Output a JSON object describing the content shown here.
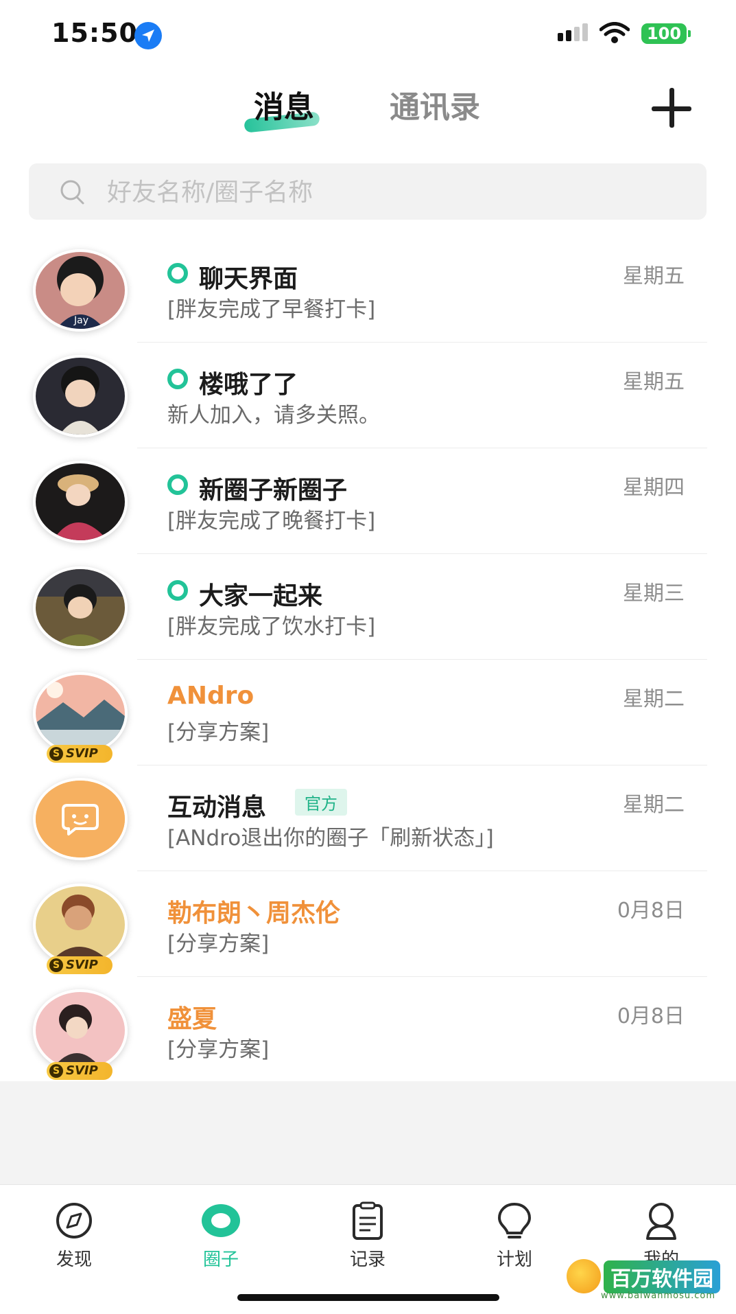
{
  "status_bar": {
    "time": "15:50",
    "battery": "100"
  },
  "header": {
    "tabs": [
      {
        "label": "消息",
        "active": true
      },
      {
        "label": "通讯录",
        "active": false
      }
    ],
    "add_icon": "plus-icon"
  },
  "search": {
    "placeholder": "好友名称/圈子名称"
  },
  "conversations": [
    {
      "title": "聊天界面",
      "subtitle": "[胖友完成了早餐打卡]",
      "date": "星期五",
      "circle": true,
      "svip": false
    },
    {
      "title": "楼哦了了",
      "subtitle": "新人加入，请多关照。",
      "date": "星期五",
      "circle": true,
      "svip": false
    },
    {
      "title": "新圈子新圈子",
      "subtitle": "[胖友完成了晚餐打卡]",
      "date": "星期四",
      "circle": true,
      "svip": false
    },
    {
      "title": "大家一起来",
      "subtitle": "[胖友完成了饮水打卡]",
      "date": "星期三",
      "circle": true,
      "svip": false
    },
    {
      "title": "ANdro",
      "subtitle": "[分享方案]",
      "date": "星期二",
      "circle": false,
      "svip": true,
      "svip_label": "SVIP",
      "svip_coin": "S"
    },
    {
      "title": "互动消息",
      "badge": "官方",
      "subtitle": "[ANdro退出你的圈子「刷新状态」]",
      "date": "星期二",
      "circle": false,
      "svip": false
    },
    {
      "title": "勒布朗丶周杰伦",
      "subtitle": "[分享方案]",
      "date": "0月8日",
      "circle": false,
      "svip": true,
      "svip_label": "SVIP",
      "svip_coin": "S"
    },
    {
      "title": "盛夏",
      "subtitle": "[分享方案]",
      "date": "0月8日",
      "circle": false,
      "svip": true,
      "svip_label": "SVIP",
      "svip_coin": "S"
    }
  ],
  "avatar_1_text": "Jay",
  "bottom_nav": [
    {
      "label": "发现",
      "icon": "compass-icon",
      "active": false
    },
    {
      "label": "圈子",
      "icon": "circle-icon",
      "active": true
    },
    {
      "label": "记录",
      "icon": "clipboard-icon",
      "active": false
    },
    {
      "label": "计划",
      "icon": "lightbulb-icon",
      "active": false
    },
    {
      "label": "我的",
      "icon": "profile-icon",
      "active": false
    }
  ],
  "watermark": {
    "text": "百万软件园",
    "url": "www.baiwanmosu.com"
  },
  "colors": {
    "accent": "#22c398",
    "vip_name": "#f0913a",
    "official_bg": "#def5ec"
  }
}
